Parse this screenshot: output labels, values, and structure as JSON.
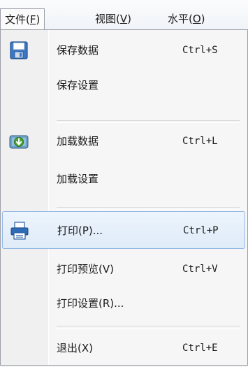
{
  "menubar": {
    "items": [
      {
        "text": "文件(",
        "accel": "F",
        "close": ")"
      },
      {
        "text": "视图(",
        "accel": "V",
        "close": ")"
      },
      {
        "text": "水平(",
        "accel": "O",
        "close": ")"
      }
    ]
  },
  "menu": {
    "save_data": {
      "label": "保存数据",
      "shortcut": "Ctrl+S",
      "icon": "save-icon"
    },
    "save_settings": {
      "label": "保存设置"
    },
    "load_data": {
      "label": "加载数据",
      "shortcut": "Ctrl+L",
      "icon": "load-icon"
    },
    "load_settings": {
      "label": "加载设置"
    },
    "print": {
      "label": "打印(P)...",
      "shortcut": "Ctrl+P",
      "icon": "printer-icon"
    },
    "print_preview": {
      "label": "打印预览(V)",
      "shortcut": "Ctrl+V"
    },
    "print_settings": {
      "label": "打印设置(R)..."
    },
    "exit": {
      "label": "退出(X)",
      "shortcut": "Ctrl+E"
    }
  },
  "colors": {
    "highlight": "#dfebf8",
    "highlight_border": "#93b8e4"
  }
}
